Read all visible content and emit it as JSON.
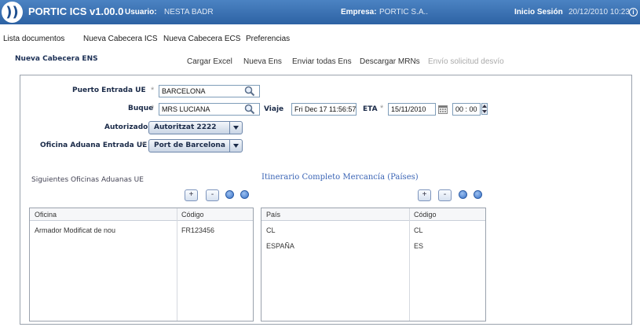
{
  "header": {
    "title": "PORTIC ICS v1.00.0",
    "usuario_label": "Usuario:",
    "usuario_value": "NESTA BADR",
    "empresa_label": "Empresa:",
    "empresa_value": "PORTIC S.A..",
    "sesion_label": "Inicio Sesión",
    "sesion_value": "20/12/2010 10:23",
    "info": "i"
  },
  "menu": {
    "items": [
      {
        "label": "Lista documentos"
      },
      {
        "label": "Nueva Cabecera ICS"
      },
      {
        "label": "Nueva Cabecera ECS"
      },
      {
        "label": "Preferencias"
      }
    ]
  },
  "section": {
    "title": "Nueva Cabecera ENS"
  },
  "toolbar": {
    "cargar_excel": "Cargar Excel",
    "nueva_ens": "Nueva Ens",
    "enviar_todas": "Enviar todas Ens",
    "descargar_mrns": "Descargar MRNs",
    "envio_desvio": "Envío solicitud desvío"
  },
  "form": {
    "puerto_label": "Puerto Entrada UE",
    "puerto_value": "BARCELONA",
    "buque_label": "Buque",
    "buque_value": "MRS LUCIANA",
    "viaje_label": "Viaje",
    "viaje_value": "Fri Dec 17 11:56:57",
    "eta_label": "ETA",
    "eta_date": "15/11/2010",
    "eta_time": "00 : 00",
    "autorizado_label": "Autorizado",
    "autorizado_value": "Autoritzat 2222",
    "oficina_label": "Oficina Aduana Entrada UE",
    "oficina_value": "Port de Barcelona",
    "required_mark": "*"
  },
  "oficinas": {
    "title": "Siguientes Oficinas Aduanas UE",
    "add": "+",
    "remove": "-",
    "columns": [
      "Oficina",
      "Código"
    ],
    "rows": [
      [
        "Armador Modificat de nou",
        "FR123456"
      ]
    ]
  },
  "itinerario": {
    "title": "Itinerario Completo Mercancía (Países)",
    "add": "+",
    "remove": "-",
    "columns": [
      "País",
      "Código"
    ],
    "rows": [
      [
        "CL",
        "CL"
      ],
      [
        "ESPAÑA",
        "ES"
      ]
    ]
  }
}
